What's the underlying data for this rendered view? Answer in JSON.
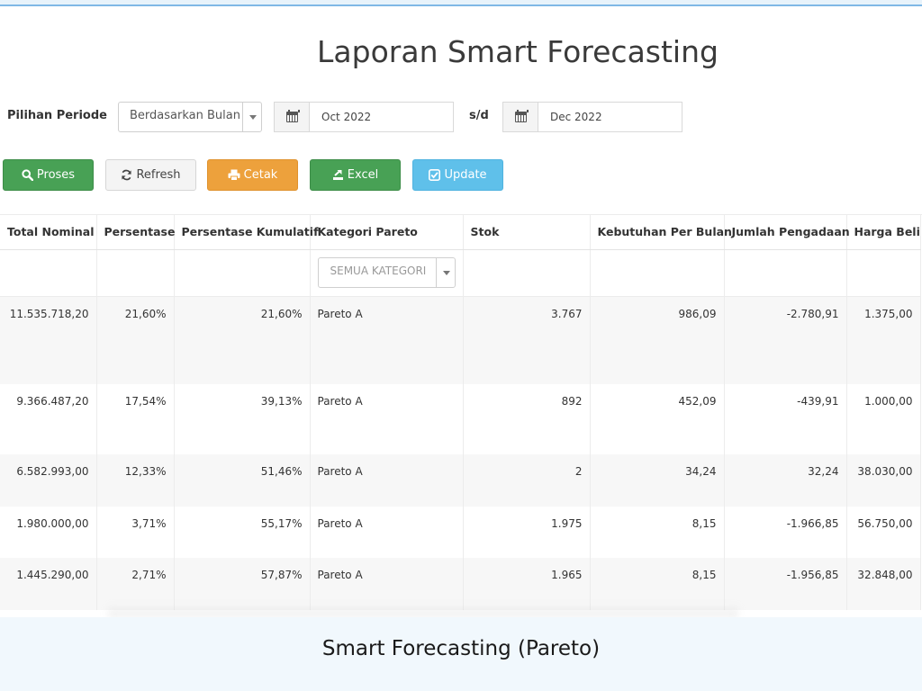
{
  "page": {
    "title": "Laporan Smart Forecasting"
  },
  "filters": {
    "period_label": "Pilihan Periode",
    "period_mode": "Berdasarkan Bulan",
    "date_from": "Oct 2022",
    "separator": "s/d",
    "date_to": "Dec 2022"
  },
  "toolbar": {
    "proses": "Proses",
    "refresh": "Refresh",
    "cetak": "Cetak",
    "excel": "Excel",
    "update": "Update"
  },
  "table": {
    "columns": [
      "Total Nominal",
      "Persentase",
      "Persentase Kumulatif",
      "Kategori Pareto",
      "Stok",
      "Kebutuhan Per Bulan",
      "Jumlah Pengadaan",
      "Harga Beli"
    ],
    "category_filter": "SEMUA KATEGORI",
    "rows": [
      [
        "11.535.718,20",
        "21,60%",
        "21,60%",
        "Pareto A",
        "3.767",
        "986,09",
        "-2.780,91",
        "1.375,00"
      ],
      [
        "9.366.487,20",
        "17,54%",
        "39,13%",
        "Pareto A",
        "892",
        "452,09",
        "-439,91",
        "1.000,00"
      ],
      [
        "6.582.993,00",
        "12,33%",
        "51,46%",
        "Pareto A",
        "2",
        "34,24",
        "32,24",
        "38.030,00"
      ],
      [
        "1.980.000,00",
        "3,71%",
        "55,17%",
        "Pareto A",
        "1.975",
        "8,15",
        "-1.966,85",
        "56.750,00"
      ],
      [
        "1.445.290,00",
        "2,71%",
        "57,87%",
        "Pareto A",
        "1.965",
        "8,15",
        "-1.956,85",
        "32.848,00"
      ]
    ]
  },
  "banner": {
    "text": "Smart Forecasting (Pareto)"
  },
  "colors": {
    "green": "#48a155",
    "orange": "#eda13c",
    "blue": "#5fc0ea",
    "grey": "#f4f4f4"
  },
  "icons": {
    "proses": "search-icon",
    "refresh": "refresh-icon",
    "cetak": "print-icon",
    "excel": "export-icon",
    "update": "check-square-icon",
    "calendar": "calendar-icon",
    "dropdown": "chevron-down-icon"
  }
}
